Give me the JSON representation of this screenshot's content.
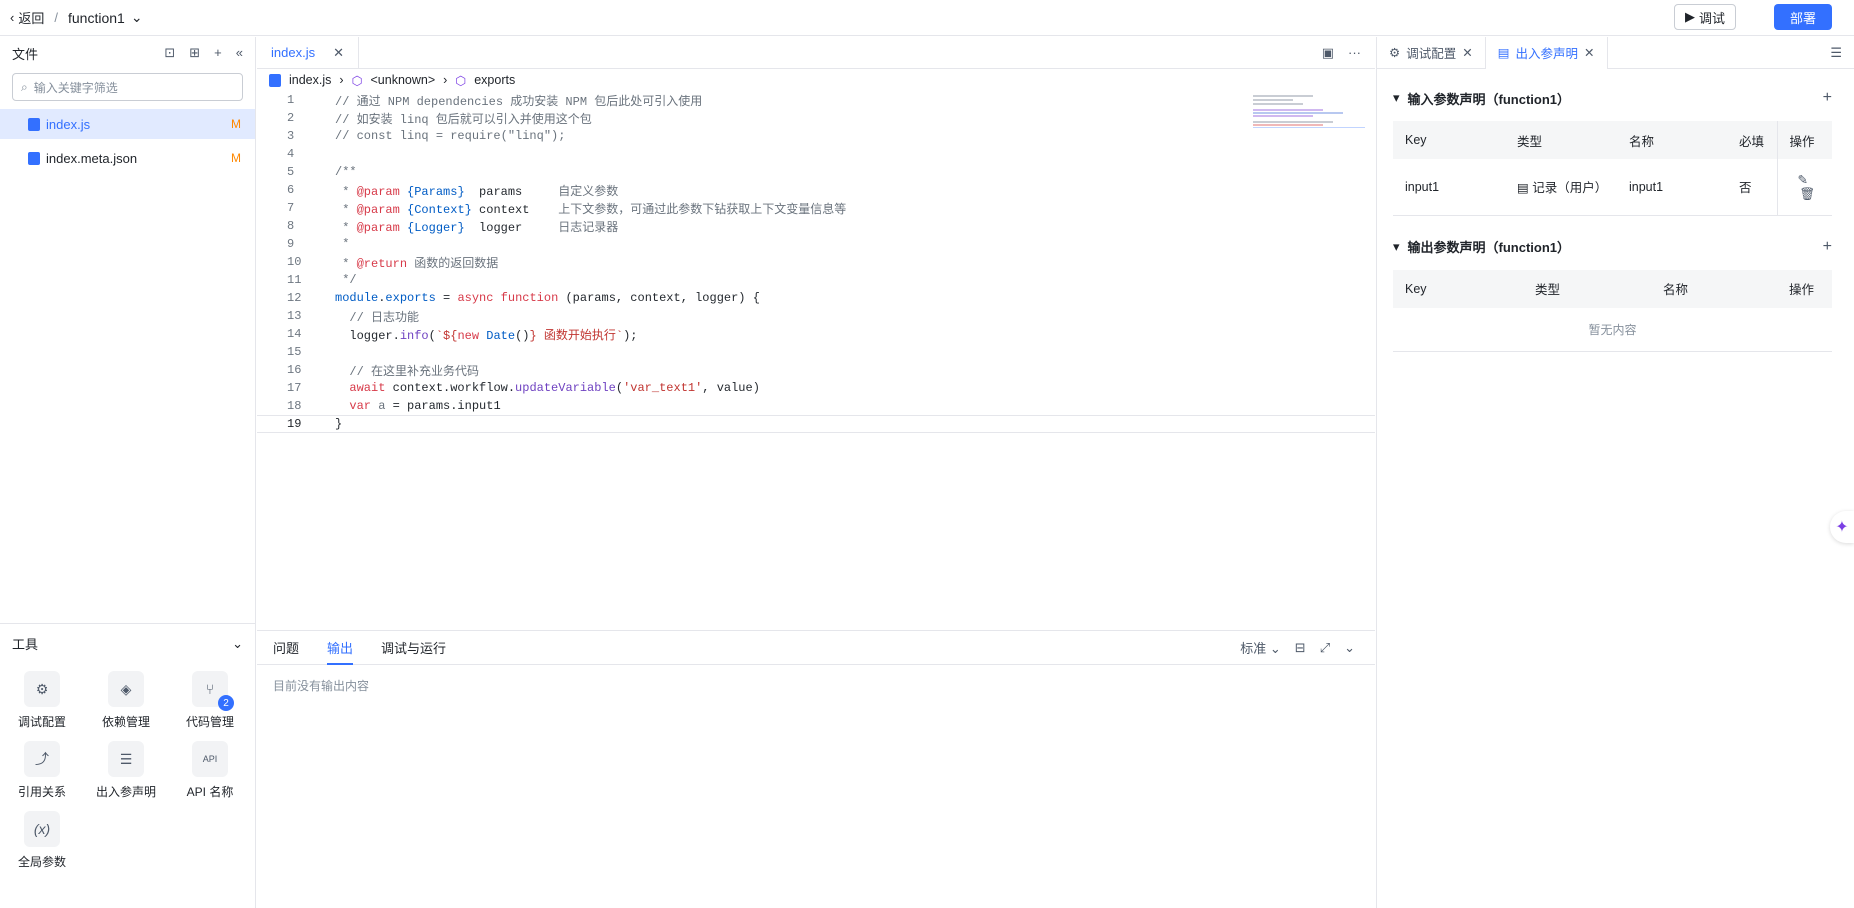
{
  "header": {
    "back_label": "返回",
    "separator": "/",
    "function_name": "function1",
    "debug_label": "调试",
    "deploy_label": "部署"
  },
  "sidebar": {
    "title": "文件",
    "search_placeholder": "输入关键字筛选",
    "files": [
      {
        "name": "index.js",
        "status": "M"
      },
      {
        "name": "index.meta.json",
        "status": "M"
      }
    ],
    "tools_title": "工具",
    "tools": [
      {
        "label": "调试配置"
      },
      {
        "label": "依赖管理"
      },
      {
        "label": "代码管理",
        "badge": "2"
      },
      {
        "label": "引用关系"
      },
      {
        "label": "出入参声明"
      },
      {
        "label": "API 名称"
      },
      {
        "label": "全局参数"
      }
    ]
  },
  "editor": {
    "tab": "index.js",
    "breadcrumb": [
      "index.js",
      "<unknown>",
      "exports"
    ],
    "line_numbers": [
      "1",
      "2",
      "3",
      "4",
      "5",
      "6",
      "7",
      "8",
      "9",
      "10",
      "11",
      "12",
      "13",
      "14",
      "15",
      "16",
      "17",
      "18",
      "19"
    ]
  },
  "bottom_panel": {
    "tabs": [
      "问题",
      "输出",
      "调试与运行"
    ],
    "active_tab": "输出",
    "level_select": "标准",
    "empty_text": "目前没有输出内容"
  },
  "right_panel": {
    "tabs": [
      "调试配置",
      "出入参声明"
    ],
    "active_tab": "出入参声明",
    "input_section": {
      "title": "输入参数声明（function1）",
      "columns": [
        "Key",
        "类型",
        "名称",
        "必填",
        "操作"
      ],
      "rows": [
        {
          "key": "input1",
          "type": "记录（用户）",
          "name": "input1",
          "required": "否"
        }
      ]
    },
    "output_section": {
      "title": "输出参数声明（function1）",
      "columns": [
        "Key",
        "类型",
        "名称",
        "操作"
      ],
      "empty_text": "暂无内容"
    }
  },
  "colors": {
    "accent": "#3370ff",
    "modified": "#ff8800"
  }
}
